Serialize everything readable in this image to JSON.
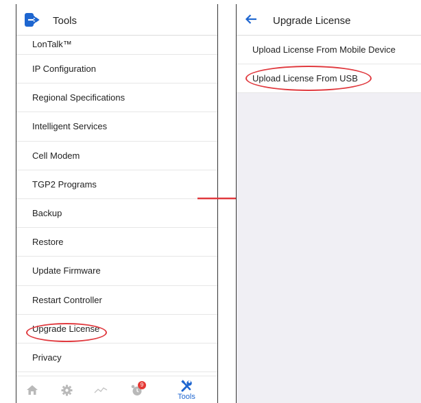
{
  "left": {
    "header": {
      "title": "Tools"
    },
    "menu": [
      {
        "label": "LonTalk™"
      },
      {
        "label": "IP Configuration"
      },
      {
        "label": "Regional Specifications"
      },
      {
        "label": "Intelligent Services"
      },
      {
        "label": "Cell Modem"
      },
      {
        "label": "TGP2 Programs"
      },
      {
        "label": "Backup"
      },
      {
        "label": "Restore"
      },
      {
        "label": "Update Firmware"
      },
      {
        "label": "Restart Controller"
      },
      {
        "label": "Upgrade License"
      },
      {
        "label": "Privacy"
      }
    ],
    "bottom_nav": {
      "alarm_badge": "9",
      "tools_label": "Tools",
      "icons": [
        "home-icon",
        "gear-icon",
        "trend-icon",
        "alarm-icon",
        "tools-icon"
      ]
    }
  },
  "right": {
    "header": {
      "title": "Upgrade License"
    },
    "options": [
      {
        "label": "Upload License From Mobile Device"
      },
      {
        "label": "Upload License From USB"
      }
    ]
  },
  "colors": {
    "accent": "#1e66d0",
    "highlight": "#e0393e",
    "badge": "#e53935",
    "panel_bg": "#f0eff4"
  }
}
